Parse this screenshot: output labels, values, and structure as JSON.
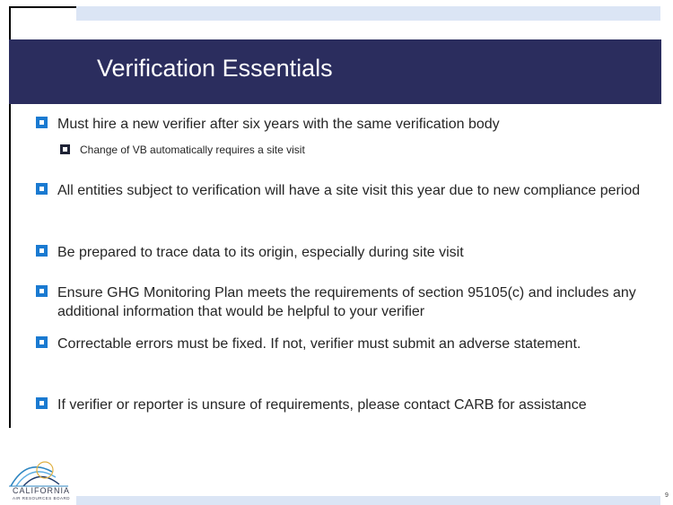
{
  "slide": {
    "title": "Verification Essentials",
    "page_number": "9"
  },
  "bullets": [
    {
      "text": "Must hire a new verifier after six years with the same verification body",
      "sub_bullets": [
        "Change of VB automatically requires a site visit"
      ]
    },
    {
      "text": "All entities subject to verification will have a site visit this year due to new compliance period"
    },
    {
      "text": "Be prepared to trace data to its origin, especially during site visit"
    },
    {
      "text": "Ensure GHG Monitoring Plan meets the requirements of section 95105(c) and includes any additional information that would be helpful to your verifier"
    },
    {
      "text": "Correctable errors must be fixed.  If not, verifier must submit an adverse statement."
    },
    {
      "text": "If verifier or reporter is unsure of requirements, please contact CARB for assistance"
    }
  ],
  "logo": {
    "name": "CALIFORNIA",
    "subtitle": "AIR RESOURCES BOARD"
  },
  "colors": {
    "title_band": "#2b2d5e",
    "bullet_marker": "#1a7ad1",
    "accent_bar": "#dbe5f5"
  }
}
